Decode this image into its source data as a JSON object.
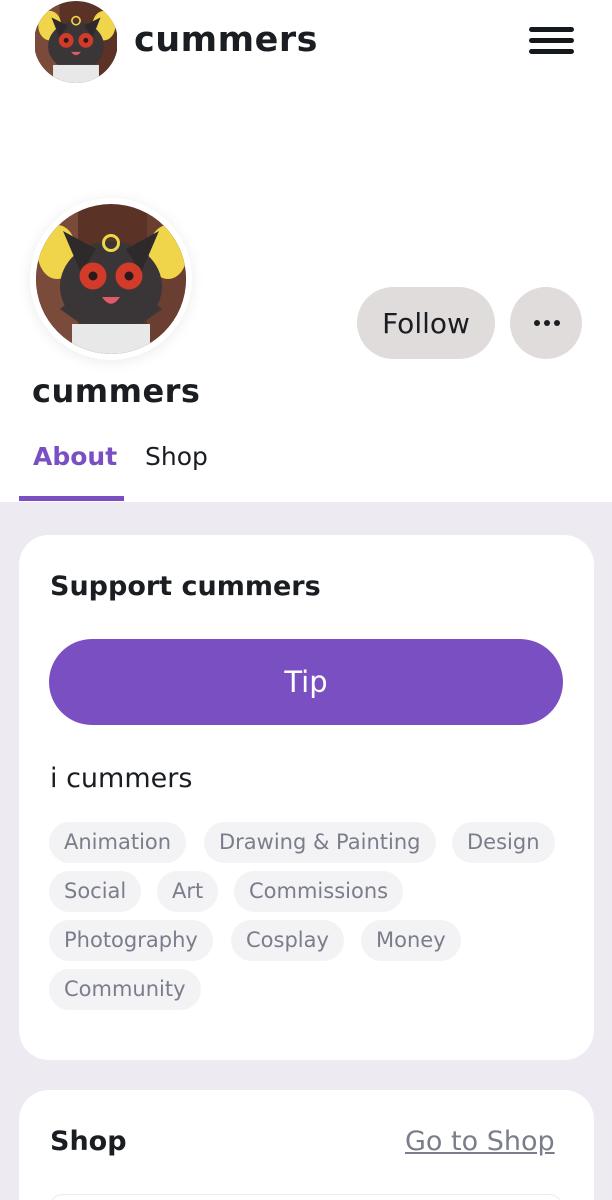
{
  "header": {
    "title": "cummers",
    "menu_icon": "hamburger-menu-icon"
  },
  "profile": {
    "name": "cummers",
    "follow_label": "Follow",
    "more_icon": "more-horizontal-icon"
  },
  "tabs": [
    {
      "label": "About",
      "active": true
    },
    {
      "label": "Shop",
      "active": false
    }
  ],
  "support": {
    "title": "Support cummers",
    "tip_label": "Tip",
    "bio": "i cummers",
    "tags": [
      "Animation",
      "Drawing & Painting",
      "Design",
      "Social",
      "Art",
      "Commissions",
      "Photography",
      "Cosplay",
      "Money",
      "Community"
    ]
  },
  "shop": {
    "title": "Shop",
    "link_label": "Go to Shop"
  },
  "colors": {
    "accent": "#7a4fc2",
    "follow_bg": "#e1dcdc",
    "content_bg": "#eeeaf2",
    "tag_bg": "#f3f2f5",
    "tag_text": "#7a7e8b"
  }
}
